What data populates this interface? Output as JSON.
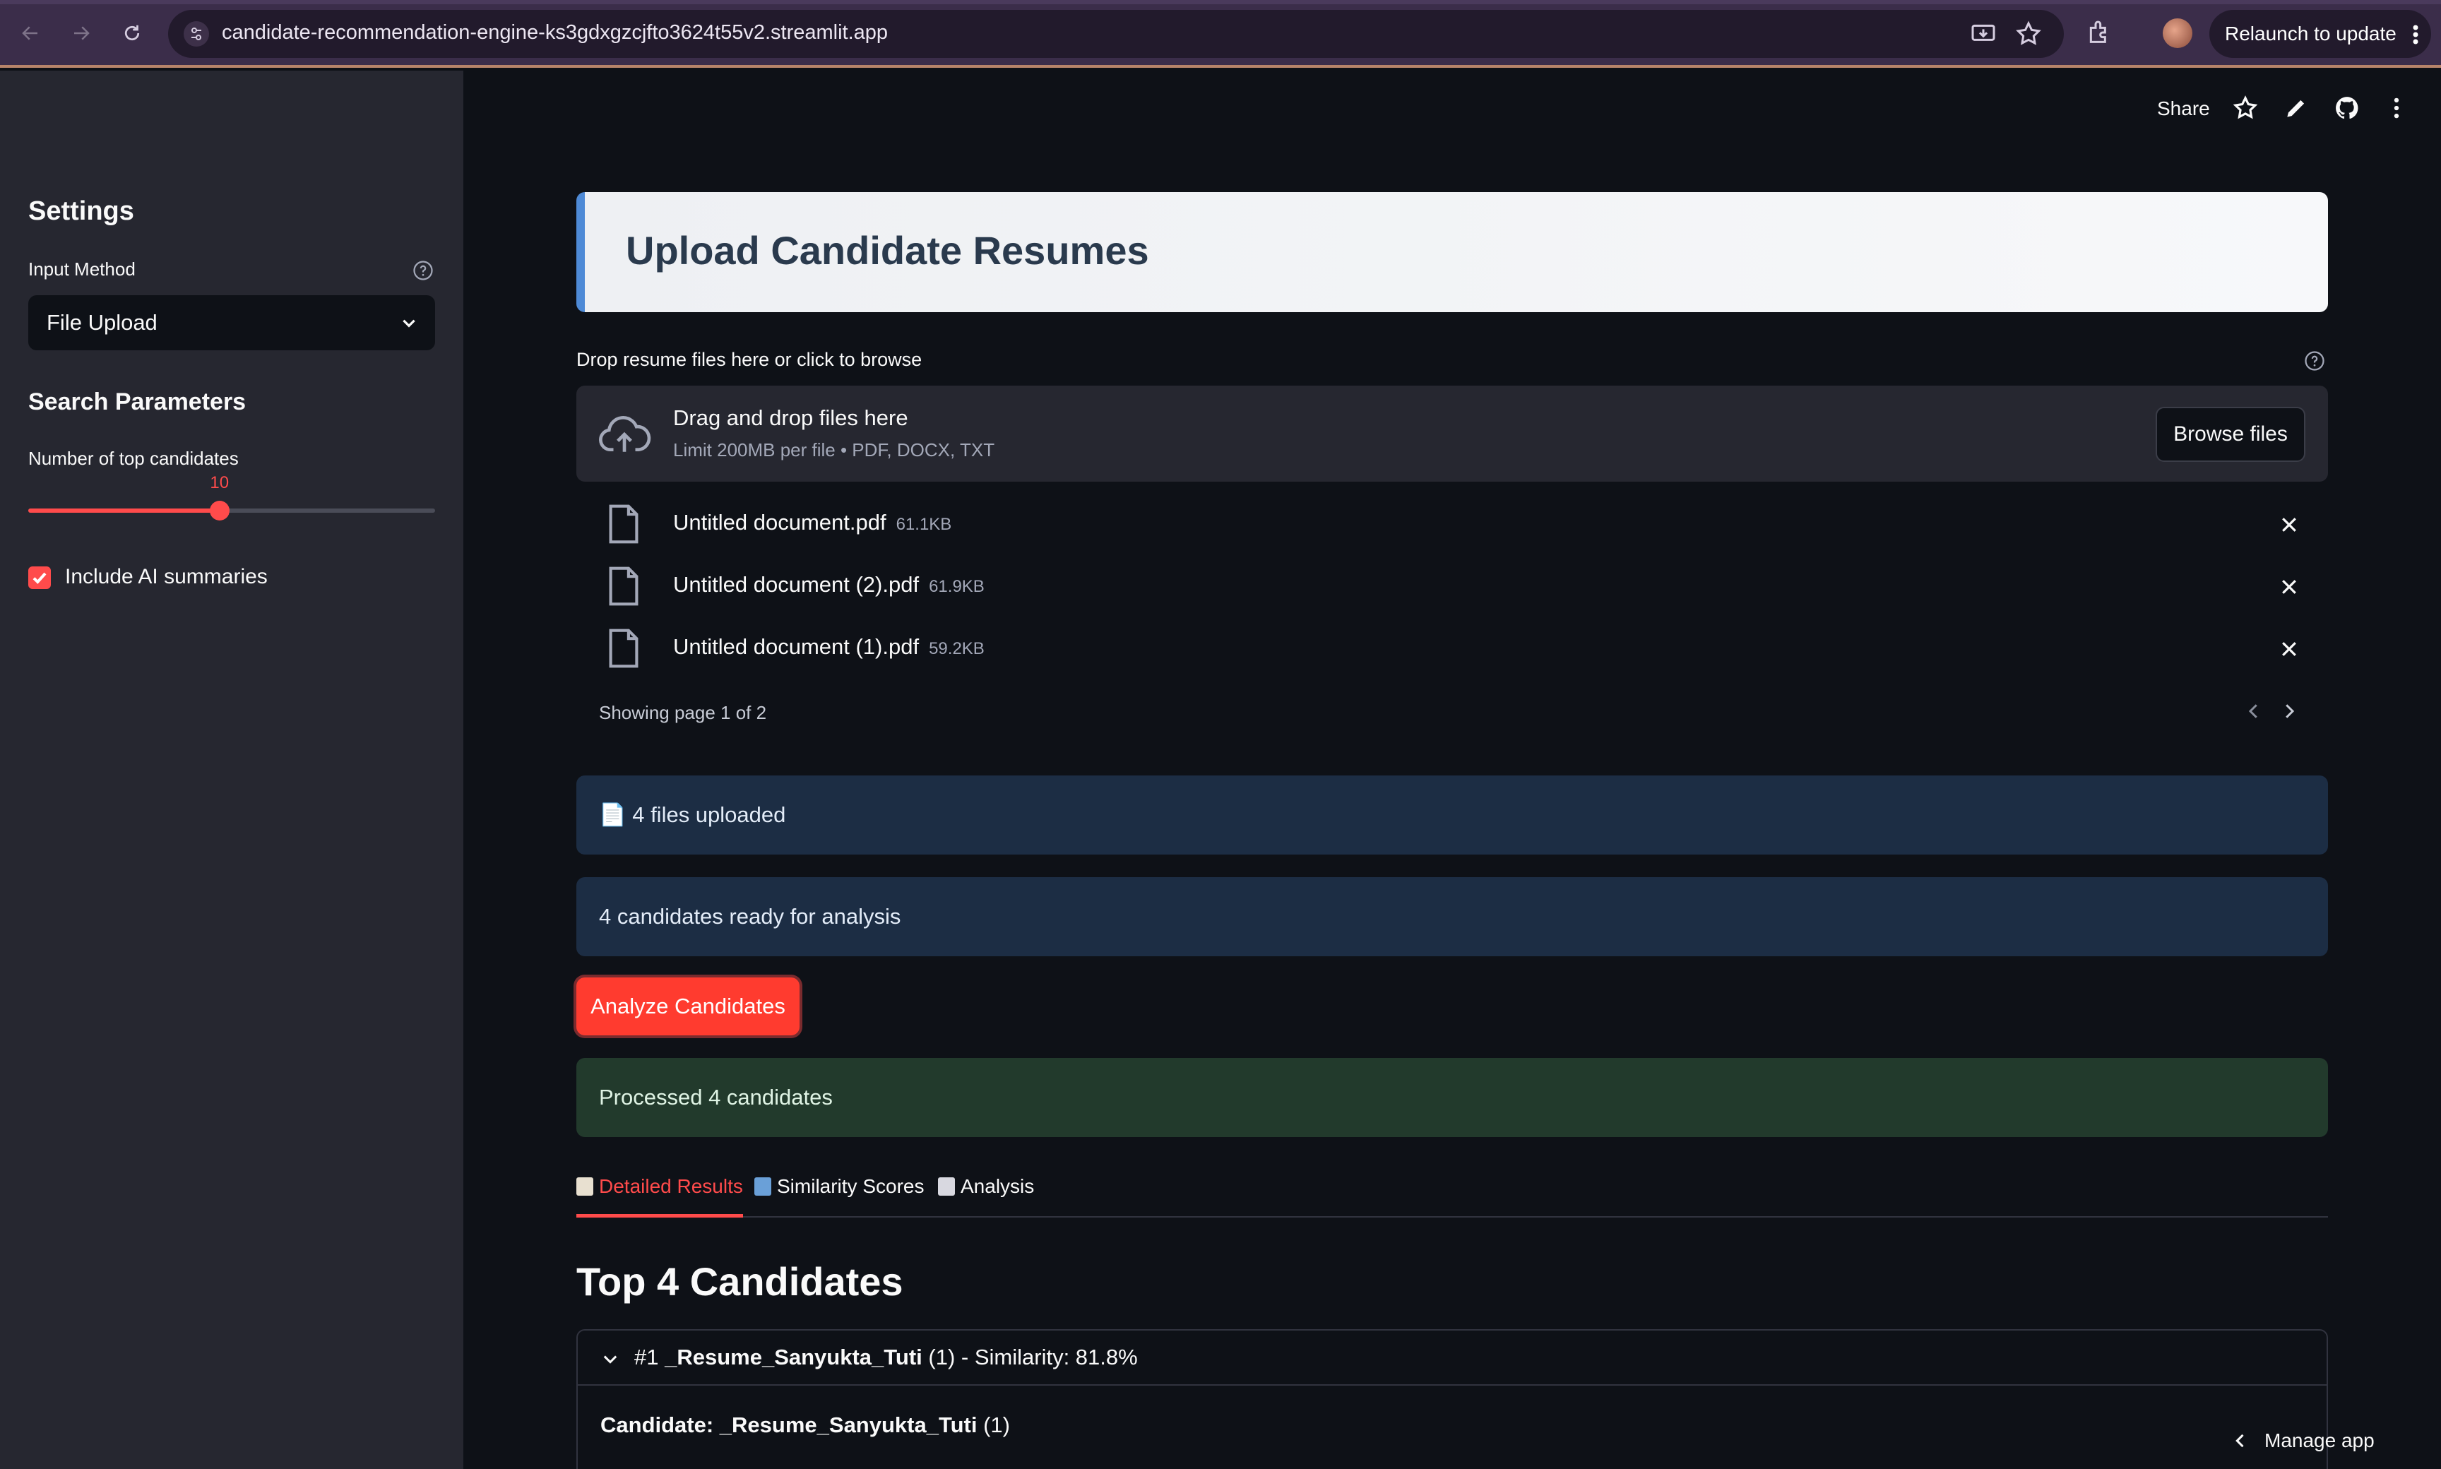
{
  "browser": {
    "url": "candidate-recommendation-engine-ks3gdxgzcjfto3624t55v2.streamlit.app",
    "relaunch_label": "Relaunch to update"
  },
  "sidebar": {
    "settings_heading": "Settings",
    "input_method_label": "Input Method",
    "input_method_value": "File Upload",
    "search_params_heading": "Search Parameters",
    "top_candidates_label": "Number of top candidates",
    "top_candidates_value": "10",
    "top_candidates_fraction": 0.47,
    "ai_summaries_label": "Include AI summaries",
    "ai_summaries_checked": true
  },
  "toolbar": {
    "share_label": "Share"
  },
  "main": {
    "header_title": "Upload Candidate Resumes",
    "uploader_label": "Drop resume files here or click to browse",
    "dropzone_title": "Drag and drop files here",
    "dropzone_subtitle": "Limit 200MB per file • PDF, DOCX, TXT",
    "browse_label": "Browse files",
    "files": [
      {
        "name": "Untitled document.pdf",
        "size": "61.1KB"
      },
      {
        "name": "Untitled document (2).pdf",
        "size": "61.9KB"
      },
      {
        "name": "Untitled document (1).pdf",
        "size": "59.2KB"
      }
    ],
    "pager_text": "Showing page 1 of 2",
    "files_uploaded": "📄 4 files uploaded",
    "candidates_ready": "4 candidates ready for analysis",
    "analyze_label": "Analyze Candidates",
    "processed": "Processed 4 candidates",
    "tabs": [
      {
        "label": "Detailed Results",
        "icon": "clipboard-icon",
        "color": "#e8e0d0"
      },
      {
        "label": "Similarity Scores",
        "icon": "bar-chart-icon",
        "color": "#6aa0d8"
      },
      {
        "label": "Analysis",
        "icon": "trend-chart-icon",
        "color": "#d8d8e0"
      }
    ],
    "results_heading": "Top 4 Candidates",
    "expander": {
      "title_prefix": "#1 ",
      "title_bold": "_Resume_Sanyukta_Tuti",
      "title_suffix": " (1) - Similarity: 81.8%",
      "candidate_label": "Candidate: ",
      "candidate_bold": "_Resume_Sanyukta_Tuti",
      "candidate_suffix": " (1)"
    }
  },
  "manage_app_label": "Manage app",
  "colors": {
    "accent": "#ff4b4b",
    "sidebar_bg": "#262730",
    "app_bg": "#0e1117",
    "info_bg": "#1c2d44",
    "success_bg": "#223a2c",
    "chrome_bg": "#3b2d4a"
  }
}
